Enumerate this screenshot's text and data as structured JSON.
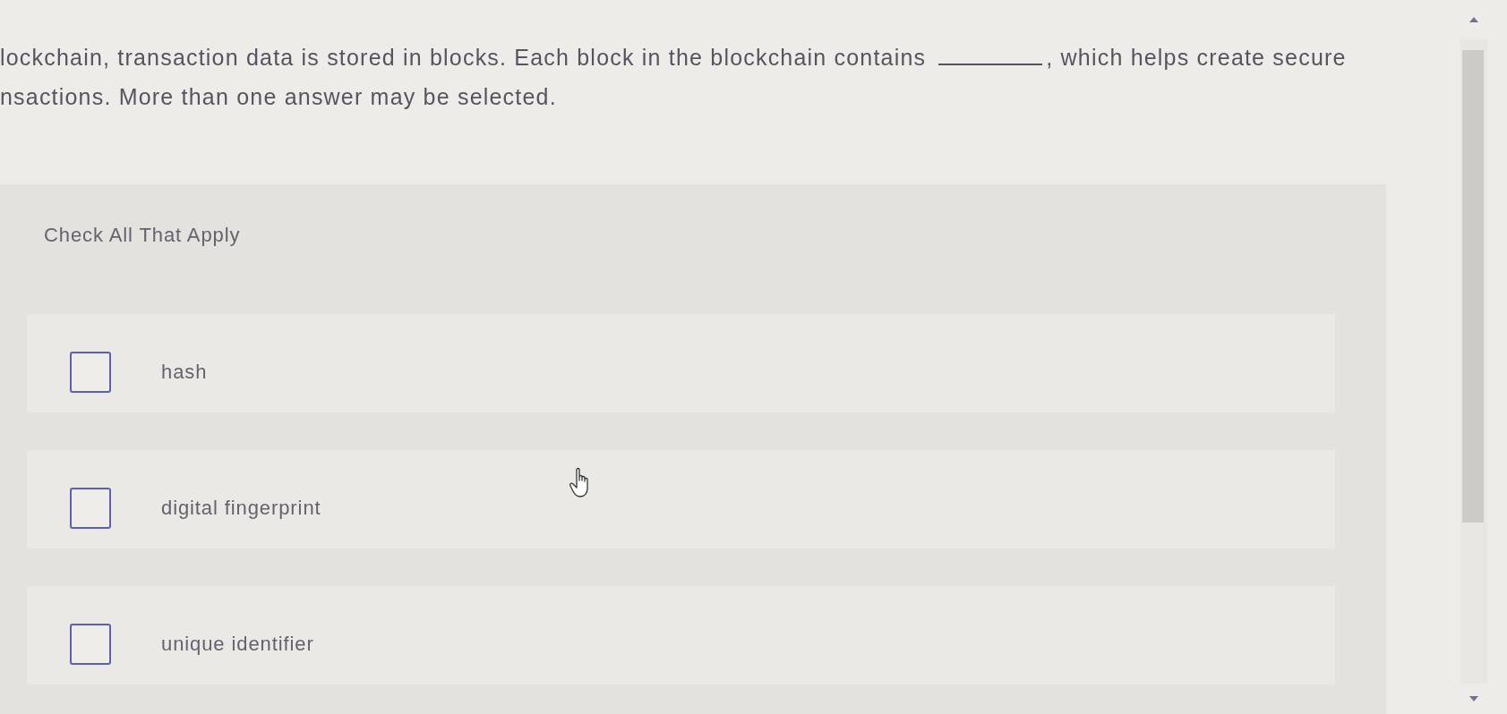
{
  "question": {
    "text_before": "lockchain, transaction data is stored in blocks. Each block in the blockchain contains",
    "text_after": ", which helps create secure",
    "line_2": "nsactions. More than one answer may be selected."
  },
  "instruction": "Check All That Apply",
  "options": [
    {
      "label": "hash",
      "checked": false
    },
    {
      "label": "digital fingerprint",
      "checked": false
    },
    {
      "label": "unique identifier",
      "checked": false
    }
  ]
}
